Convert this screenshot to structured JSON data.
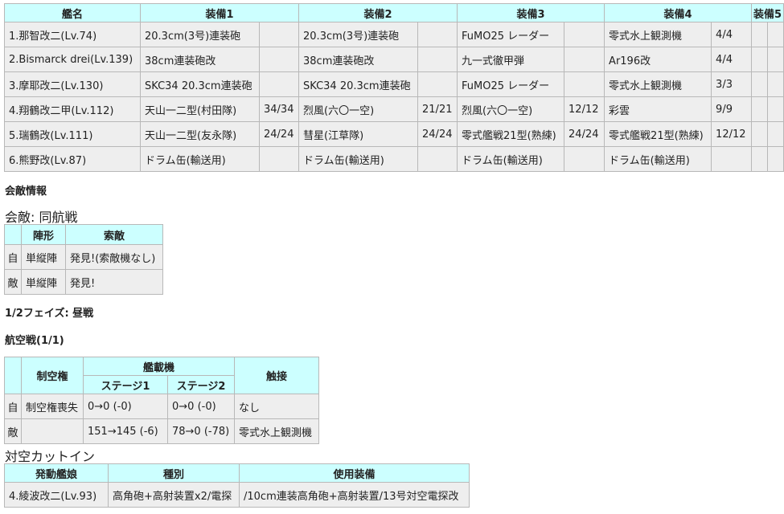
{
  "fleet": {
    "headers": [
      "艦名",
      "装備1",
      "装備2",
      "装備3",
      "装備4",
      "装備5"
    ],
    "rows": [
      {
        "name": "1.那智改二(Lv.74)",
        "eq": [
          [
            "20.3cm(3号)連装砲",
            ""
          ],
          [
            "20.3cm(3号)連装砲",
            ""
          ],
          [
            "FuMO25 レーダー",
            ""
          ],
          [
            "零式水上観測機",
            "4/4"
          ],
          [
            "",
            ""
          ]
        ]
      },
      {
        "name": "2.Bismarck drei(Lv.139)",
        "eq": [
          [
            "38cm連装砲改",
            ""
          ],
          [
            "38cm連装砲改",
            ""
          ],
          [
            "九一式徹甲弾",
            ""
          ],
          [
            "Ar196改",
            "4/4"
          ],
          [
            "",
            ""
          ]
        ]
      },
      {
        "name": "3.摩耶改二(Lv.130)",
        "eq": [
          [
            "SKC34 20.3cm連装砲",
            ""
          ],
          [
            "SKC34 20.3cm連装砲",
            ""
          ],
          [
            "FuMO25 レーダー",
            ""
          ],
          [
            "零式水上観測機",
            "3/3"
          ],
          [
            "",
            ""
          ]
        ]
      },
      {
        "name": "4.翔鶴改二甲(Lv.112)",
        "eq": [
          [
            "天山一二型(村田隊)",
            "34/34"
          ],
          [
            "烈風(六〇一空)",
            "21/21"
          ],
          [
            "烈風(六〇一空)",
            "12/12"
          ],
          [
            "彩雲",
            "9/9"
          ],
          [
            "",
            ""
          ]
        ]
      },
      {
        "name": "5.瑞鶴改(Lv.111)",
        "eq": [
          [
            "天山一二型(友永隊)",
            "24/24"
          ],
          [
            "彗星(江草隊)",
            "24/24"
          ],
          [
            "零式艦戦21型(熟練)",
            "24/24"
          ],
          [
            "零式艦戦21型(熟練)",
            "12/12"
          ],
          [
            "",
            ""
          ]
        ]
      },
      {
        "name": "6.熊野改(Lv.87)",
        "eq": [
          [
            "ドラム缶(輸送用)",
            ""
          ],
          [
            "ドラム缶(輸送用)",
            ""
          ],
          [
            "ドラム缶(輸送用)",
            ""
          ],
          [
            "ドラム缶(輸送用)",
            ""
          ],
          [
            "",
            ""
          ]
        ]
      }
    ]
  },
  "engagement": {
    "section_title": "会敵情報",
    "subtitle": "会敵: 同航戦",
    "headers": [
      "",
      "陣形",
      "索敵"
    ],
    "rows": [
      [
        "自",
        "単縦陣",
        "発見!(索敵機なし)"
      ],
      [
        "敵",
        "単縦陣",
        "発見!"
      ]
    ]
  },
  "phase_title": "1/2フェイズ: 昼戦",
  "air": {
    "title": "航空戦(1/1)",
    "header_air_control": "制空権",
    "header_carrier_planes": "艦載機",
    "header_stage1": "ステージ1",
    "header_stage2": "ステージ2",
    "header_contact": "触接",
    "rows": [
      [
        "自",
        "制空権喪失",
        "0→0 (-0)",
        "0→0 (-0)",
        "なし"
      ],
      [
        "敵",
        "",
        "151→145 (-6)",
        "78→0 (-78)",
        "零式水上観測機"
      ]
    ]
  },
  "aaci": {
    "title": "対空カットイン",
    "headers": [
      "発動艦娘",
      "種別",
      "使用装備"
    ],
    "row": [
      "4.綾波改二(Lv.93)",
      "高角砲+高射装置x2/電探",
      "/10cm連装高角砲+高射装置/13号対空電探改"
    ]
  }
}
